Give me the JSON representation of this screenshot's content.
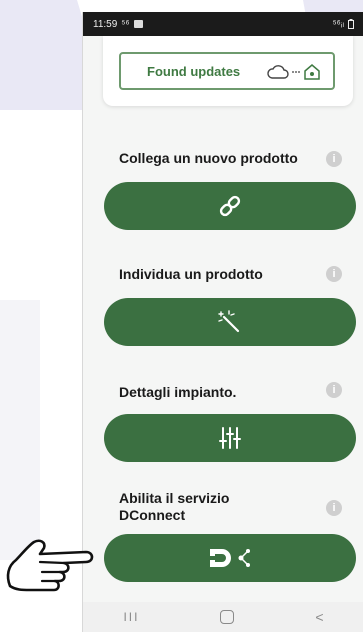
{
  "status_bar": {
    "time": "11:59",
    "left_icons": "⁵⁶",
    "right_icons": "⁵⁶ᵢₗ"
  },
  "updates": {
    "label": "Found updates",
    "icons": [
      "cloud-icon",
      "home-icon"
    ]
  },
  "sections": [
    {
      "title": "Collega un nuovo prodotto",
      "button_icon": "link-icon"
    },
    {
      "title": "Individua un prodotto",
      "button_icon": "magic-wand-icon"
    },
    {
      "title": "Dettagli impianto.",
      "button_icon": "sliders-icon"
    },
    {
      "title": "Abilita il servizio\nDConnect",
      "button_icon": "dconnect-logo-icon"
    }
  ],
  "info_glyph": "i",
  "nav": {
    "recents_glyph": "III",
    "back_glyph": "<"
  },
  "colors": {
    "button_green": "#3b7041",
    "outline_green": "#6e9a6e",
    "accent_bg": "#e9e8f5"
  }
}
